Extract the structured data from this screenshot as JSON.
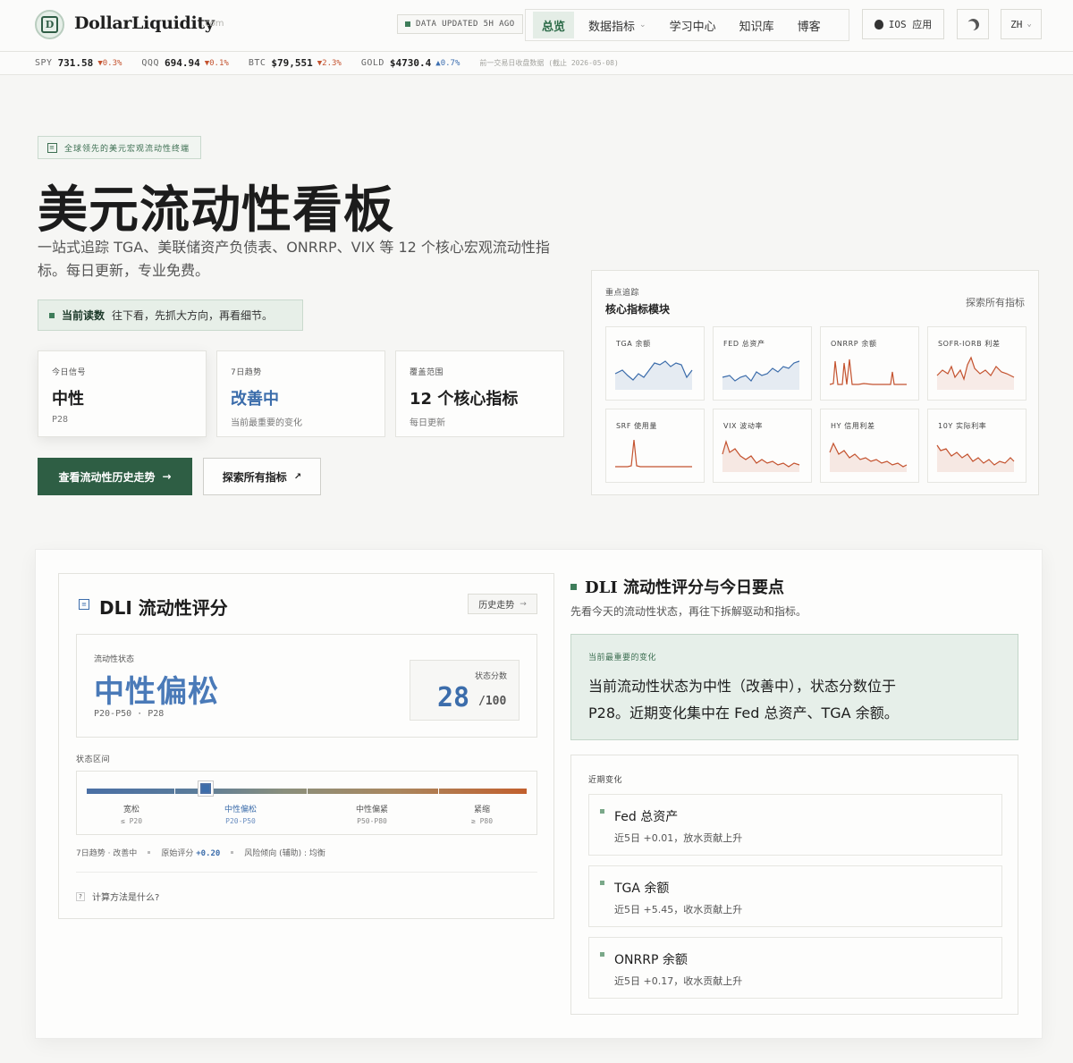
{
  "header": {
    "brand": "DollarLiquidity",
    "brand_tld": ".com",
    "updated": "DATA UPDATED 5H AGO",
    "nav": [
      {
        "label": "总览",
        "active": true
      },
      {
        "label": "数据指标",
        "dropdown": true
      },
      {
        "label": "学习中心"
      },
      {
        "label": "知识库"
      },
      {
        "label": "博客"
      }
    ],
    "ios_label": "IOS 应用",
    "lang": "ZH"
  },
  "ticker": {
    "items": [
      {
        "sym": "SPY",
        "val": "731.58",
        "chg": "▼0.3%",
        "dir": "down"
      },
      {
        "sym": "QQQ",
        "val": "694.94",
        "chg": "▼0.1%",
        "dir": "down"
      },
      {
        "sym": "BTC",
        "val": "$79,551",
        "chg": "▼2.3%",
        "dir": "down"
      },
      {
        "sym": "GOLD",
        "val": "$4730.4",
        "chg": "▲0.7%",
        "dir": "up"
      }
    ],
    "note": "前一交易日收盘数据 (截止 2026-05-08)"
  },
  "hero": {
    "badge": "全球领先的美元宏观流动性终端",
    "title": "美元流动性看板",
    "subtitle": "一站式追踪 TGA、美联储资产负债表、ONRRP、VIX 等 12 个核心宏观流动性指标。每日更新，专业免费。",
    "reading_bold": "当前读数",
    "reading_text": "往下看，先抓大方向，再看细节。",
    "stats": [
      {
        "label": "今日信号",
        "value": "中性",
        "sub": "P28"
      },
      {
        "label": "7日趋势",
        "value": "改善中",
        "sub": "当前最重要的变化"
      },
      {
        "label": "覆盖范围",
        "value": "12 个核心指标",
        "sub": "每日更新"
      }
    ],
    "primary_btn": "查看流动性历史走势",
    "secondary_btn": "探索所有指标"
  },
  "core": {
    "eyebrow": "重点追踪",
    "title": "核心指标模块",
    "explore": "探索所有指标",
    "modules": [
      {
        "label": "TGA 余额",
        "color": "#3c6dab"
      },
      {
        "label": "FED 总资产",
        "color": "#3c6dab"
      },
      {
        "label": "ONRRP 余额",
        "color": "#c4532f"
      },
      {
        "label": "SOFR-IORB 利差",
        "color": "#c4532f"
      },
      {
        "label": "SRF 使用量",
        "color": "#c4532f"
      },
      {
        "label": "VIX 波动率",
        "color": "#c4532f"
      },
      {
        "label": "HY 信用利差",
        "color": "#c4532f"
      },
      {
        "label": "10Y 实际利率",
        "color": "#c4532f"
      }
    ]
  },
  "dli": {
    "title": "DLI 流动性评分",
    "history_btn": "历史走势",
    "state_label": "流动性状态",
    "state": "中性偏松",
    "range": "P20-P50 · P28",
    "score_label": "状态分数",
    "score": "28",
    "score_den": "/100",
    "score_fraction": 0.28,
    "zone_label": "状态区间",
    "zones": [
      {
        "name": "宽松",
        "range": "≤ P20"
      },
      {
        "name": "中性偏松",
        "range": "P20-P50"
      },
      {
        "name": "中性偏紧",
        "range": "P50-P80"
      },
      {
        "name": "紧缩",
        "range": "≥ P80"
      }
    ],
    "meta_trend": "7日趋势 · 改善中",
    "meta_raw_label": "原始评分",
    "meta_raw_value": "+0.20",
    "meta_risk": "风险倾向 (辅助) : 均衡",
    "calc": "计算方法是什么?"
  },
  "summary": {
    "title": "DLI 流动性评分与今日要点",
    "subtitle": "先看今天的流动性状态，再往下拆解驱动和指标。",
    "change_label": "当前最重要的变化",
    "change_text": "当前流动性状态为中性（改善中），状态分数位于 P28。近期变化集中在 Fed 总资产、TGA 余额。",
    "recent_label": "近期变化",
    "recent": [
      {
        "name": "Fed 总资产",
        "desc": "近5日 +0.01，放水贡献上升"
      },
      {
        "name": "TGA 余额",
        "desc": "近5日 +5.45，收水贡献上升"
      },
      {
        "name": "ONRRP 余额",
        "desc": "近5日 +0.17，收水贡献上升"
      }
    ]
  }
}
